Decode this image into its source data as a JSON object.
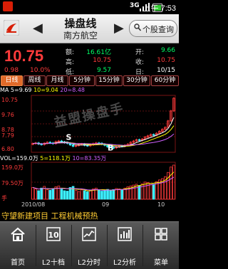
{
  "status_bar": {
    "network": "3G",
    "time": "上午 7:53"
  },
  "header": {
    "title": "操盘线",
    "stock_name": "南方航空",
    "prev_icon": "left-arrow",
    "next_icon": "right-arrow",
    "search_label": "个股查询"
  },
  "quote": {
    "price": "10.75",
    "change": "0.98",
    "change_pct": "10.0%",
    "stats": [
      {
        "label": "额:",
        "value": "16.61亿",
        "label2": "开:",
        "value2": "9.66"
      },
      {
        "label": "高:",
        "value": "10.75",
        "label2": "收:",
        "value2": "10.75"
      },
      {
        "label": "低:",
        "value": "9.57",
        "label2": "日:",
        "value2": "10/15"
      }
    ]
  },
  "tabs": [
    "日线",
    "周线",
    "月线",
    "5分钟",
    "15分钟",
    "30分钟",
    "60分钟"
  ],
  "active_tab": 0,
  "ma_legend": [
    {
      "text": "MA 5=9.69",
      "color": "#ffffff"
    },
    {
      "text": "10=9.04",
      "color": "#ffff00"
    },
    {
      "text": "20=8.48",
      "color": "#d060ff"
    }
  ],
  "vol_legend": [
    {
      "text": "VOL=159.0万",
      "color": "#ffffff"
    },
    {
      "text": "5=118.1万",
      "color": "#ffff00"
    },
    {
      "text": "10=83.35万",
      "color": "#d060ff"
    }
  ],
  "price_axis": [
    "10.75",
    "9.76",
    "8.78",
    "7.79",
    "6.80"
  ],
  "volume_axis": [
    "159.0万",
    "79.50万",
    "手"
  ],
  "date_axis": [
    "2010/08",
    "09",
    "10"
  ],
  "watermark": "益盟操盘手",
  "chart_data": {
    "type": "candlestick",
    "ylim": [
      6.8,
      10.75
    ],
    "volume_ylim": [
      0,
      159.0
    ],
    "x_ticks": [
      "2010/08",
      "09",
      "10"
    ],
    "close": [
      7.25,
      7.3,
      7.22,
      7.18,
      7.28,
      7.35,
      7.3,
      7.25,
      7.4,
      7.45,
      7.38,
      7.32,
      7.28,
      7.15,
      7.05,
      7.1,
      7.18,
      7.22,
      7.12,
      7.08,
      7.15,
      7.25,
      7.3,
      7.28,
      7.2,
      7.12,
      7.0,
      6.95,
      6.92,
      7.0,
      7.08,
      7.05,
      7.12,
      7.2,
      7.35,
      7.45,
      7.55,
      7.5,
      7.6,
      7.75,
      7.85,
      7.95,
      7.9,
      8.05,
      8.2,
      8.35,
      8.5,
      9.0,
      9.77,
      10.75
    ],
    "volume": [
      55,
      48,
      40,
      52,
      60,
      45,
      42,
      50,
      58,
      62,
      47,
      40,
      38,
      55,
      60,
      42,
      36,
      44,
      40,
      35,
      42,
      48,
      52,
      44,
      38,
      40,
      46,
      42,
      45,
      50,
      48,
      44,
      52,
      58,
      62,
      66,
      70,
      64,
      72,
      80,
      78,
      74,
      70,
      82,
      90,
      96,
      105,
      125,
      150,
      159
    ]
  },
  "ticker": "守望新建项目 工程机械预热",
  "nav": [
    "首页",
    "L2十档",
    "L2分时",
    "L2分析",
    "菜单"
  ]
}
